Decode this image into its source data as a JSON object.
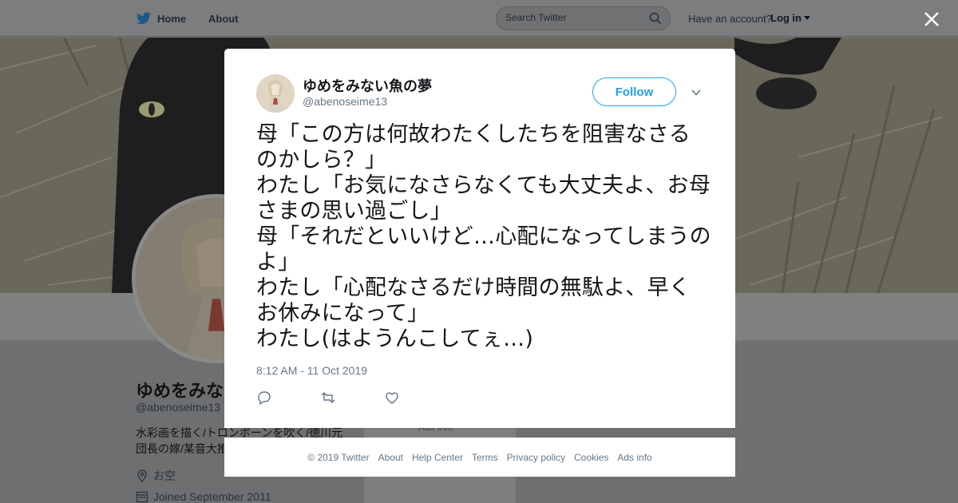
{
  "nav": {
    "home_label": "Home",
    "about_label": "About",
    "search_placeholder": "Search Twitter",
    "have_account": "Have an account?",
    "login_label": "Log in"
  },
  "profile": {
    "name": "ゆめをみない魚の夢",
    "handle": "@abenoseime13",
    "bio": "水彩画を描く/トロンボーンを吹く/徳川元団長の嫁/某音大推",
    "location": "お空",
    "joined": "Joined September 2011"
  },
  "sidebar": {
    "ads_info": "Ads info"
  },
  "tweet": {
    "author_name": "ゆめをみない魚の夢",
    "author_handle": "@abenoseime13",
    "follow_label": "Follow",
    "text": "母「この方は何故わたくしたちを阻害なさるのかしら？」\nわたし「お気になさらなくても大丈夫よ、お母さまの思い過ごし」\n母「それだといいけど…心配になってしまうのよ」\nわたし「心配なさるだけ時間の無駄よ、早くお休みになって」\nわたし(はようんこしてぇ…)",
    "timestamp": "8:12 AM - 11 Oct 2019",
    "actions": [
      "reply-icon",
      "retweet-icon",
      "like-icon"
    ]
  },
  "footer": {
    "links": [
      "© 2019 Twitter",
      "About",
      "Help Center",
      "Terms",
      "Privacy policy",
      "Cookies",
      "Ads info"
    ]
  },
  "colors": {
    "accent": "#1da1f2",
    "overlay_gray": "#7b7d7f",
    "muted_text": "#657786"
  }
}
